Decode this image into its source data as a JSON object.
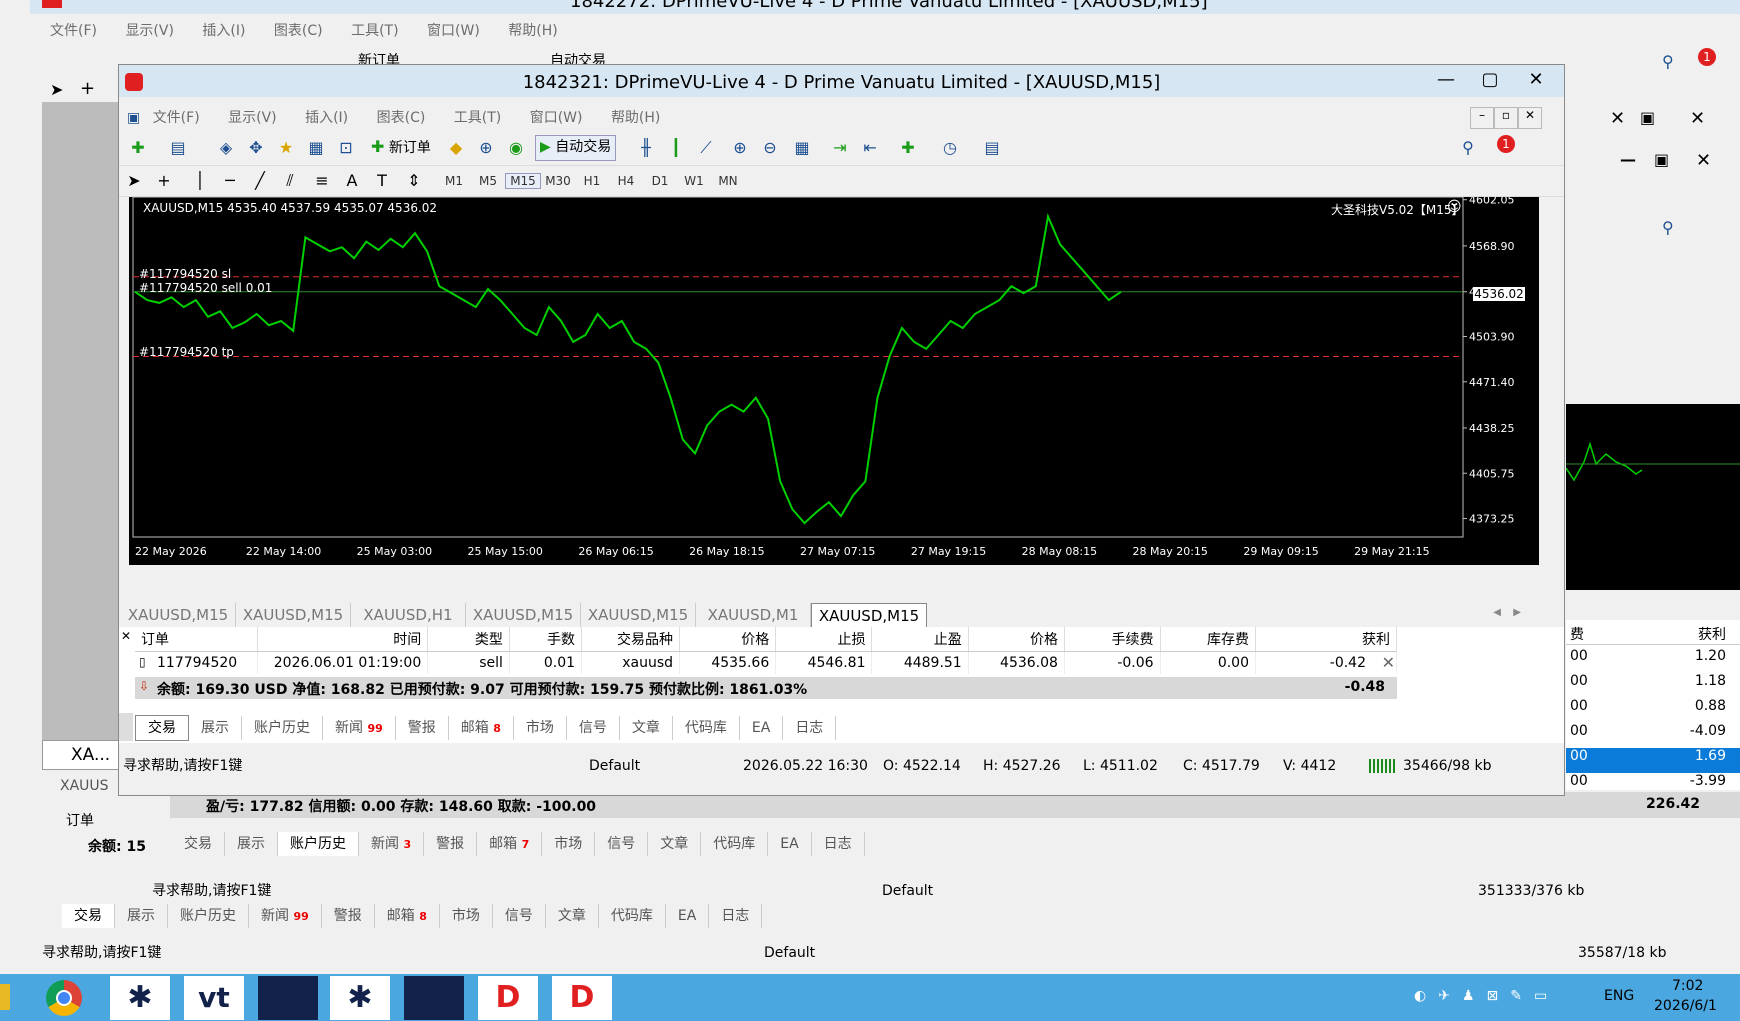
{
  "back_window": {
    "title": "1842272: DPrimeVU-Live 4 - D Prime Vanuatu Limited - [XAUUSD,M15]",
    "menu": [
      "文件(F)",
      "显示(V)",
      "插入(I)",
      "图表(C)",
      "工具(T)",
      "窗口(W)",
      "帮助(H)"
    ],
    "toolbar": {
      "new_order": "新订单",
      "auto_trade": "自动交易"
    },
    "notif_count": "1",
    "left_tab": "XA...",
    "left_tab2": "XAUUS",
    "orders_header": "订单",
    "balance_short": "余额: 15",
    "summary": "盈/亏: 177.82  信用额: 0.00  存款: 148.60  取款: -100.00",
    "summary_total": "226.42",
    "tabs": [
      "交易",
      "展示",
      "账户历史",
      "新闻",
      "警报",
      "邮箱",
      "市场",
      "信号",
      "文章",
      "代码库",
      "EA",
      "日志"
    ],
    "news_badge": "3",
    "mail_badge": "7",
    "status_help": "寻求帮助,请按F1键",
    "status_profile": "Default",
    "status_kb": "351333/376 kb",
    "right_col_header": [
      "费",
      "获利"
    ],
    "right_col_values": [
      "1.20",
      "1.18",
      "0.88",
      "-4.09",
      "1.69",
      "-3.99"
    ],
    "right_col_left": [
      "00",
      "00",
      "00",
      "00",
      "00",
      "00"
    ]
  },
  "bottom_window": {
    "tabs": [
      "交易",
      "展示",
      "账户历史",
      "新闻",
      "警报",
      "邮箱",
      "市场",
      "信号",
      "文章",
      "代码库",
      "EA",
      "日志"
    ],
    "news_badge": "99",
    "mail_badge": "8",
    "status_help": "寻求帮助,请按F1键",
    "status_profile": "Default",
    "status_kb": "35587/18 kb"
  },
  "main_window": {
    "title": "1842321: DPrimeVU-Live 4 - D Prime Vanuatu Limited - [XAUUSD,M15]",
    "menu": [
      "文件(F)",
      "显示(V)",
      "插入(I)",
      "图表(C)",
      "工具(T)",
      "窗口(W)",
      "帮助(H)"
    ],
    "toolbar": {
      "new_order": "新订单",
      "auto_trade": "自动交易"
    },
    "notif_count": "1",
    "timeframes": [
      "M1",
      "M5",
      "M15",
      "M30",
      "H1",
      "H4",
      "D1",
      "W1",
      "MN"
    ],
    "active_timeframe": "M15",
    "chart_header": "XAUUSD,M15  4535.40 4537.59 4535.07 4536.02",
    "indicator_label": "大圣科技V5.02【M15】",
    "sl_label": "#117794520 sl",
    "sell_label": "#117794520 sell 0.01",
    "tp_label": "#117794520 tp",
    "current_price": "4536.02",
    "chart_tabs": [
      "XAUUSD,M15",
      "XAUUSD,M15",
      "XAUUSD,H1",
      "XAUUSD,M15",
      "XAUUSD,M15",
      "XAUUSD,M1",
      "XAUUSD,M15"
    ],
    "orders_table": {
      "headers": [
        "订单",
        "时间",
        "类型",
        "手数",
        "交易品种",
        "价格",
        "止损",
        "止盈",
        "价格",
        "手续费",
        "库存费",
        "获利"
      ],
      "row": [
        "117794520",
        "2026.06.01 01:19:00",
        "sell",
        "0.01",
        "xauusd",
        "4535.66",
        "4546.81",
        "4489.51",
        "4536.08",
        "-0.06",
        "0.00",
        "-0.42"
      ],
      "summary": "余额: 169.30 USD  净值: 168.82  已用预付款: 9.07  可用预付款: 159.75  预付款比例: 1861.03%",
      "summary_total": "-0.48"
    },
    "tabs": [
      "交易",
      "展示",
      "账户历史",
      "新闻",
      "警报",
      "邮箱",
      "市场",
      "信号",
      "文章",
      "代码库",
      "EA",
      "日志"
    ],
    "news_badge": "99",
    "mail_badge": "8",
    "status": {
      "help": "寻求帮助,请按F1键",
      "profile": "Default",
      "datetime": "2026.05.22 16:30",
      "open": "O: 4522.14",
      "high": "H: 4527.26",
      "low": "L: 4511.02",
      "close": "C: 4517.79",
      "volume": "V: 4412",
      "kb": "35466/98 kb"
    }
  },
  "chart_data": {
    "type": "line",
    "title": "XAUUSD,M15",
    "x_ticks": [
      "22 May 2026",
      "22 May 14:00",
      "25 May 03:00",
      "25 May 15:00",
      "26 May 06:15",
      "26 May 18:15",
      "27 May 07:15",
      "27 May 19:15",
      "28 May 08:15",
      "28 May 20:15",
      "29 May 09:15",
      "29 May 21:15"
    ],
    "y_ticks": [
      4602.05,
      4568.9,
      4536.02,
      4503.9,
      4471.4,
      4438.25,
      4405.75,
      4373.25
    ],
    "ylim": [
      4360,
      4604
    ],
    "series": [
      {
        "values": [
          4536,
          4530,
          4528,
          4532,
          4525,
          4530,
          4518,
          4522,
          4510,
          4514,
          4520,
          4512,
          4515,
          4508,
          4575,
          4570,
          4565,
          4568,
          4560,
          4572,
          4566,
          4574,
          4568,
          4578,
          4565,
          4540,
          4535,
          4530,
          4525,
          4538,
          4530,
          4520,
          4510,
          4505,
          4525,
          4515,
          4500,
          4505,
          4520,
          4510,
          4515,
          4500,
          4495,
          4485,
          4460,
          4430,
          4420,
          4440,
          4450,
          4455,
          4450,
          4460,
          4445,
          4400,
          4380,
          4370,
          4378,
          4385,
          4375,
          4390,
          4400,
          4460,
          4490,
          4510,
          4500,
          4495,
          4505,
          4515,
          4510,
          4520,
          4525,
          4530,
          4540,
          4535,
          4540,
          4590,
          4570,
          4560,
          4550,
          4540,
          4530,
          4536
        ]
      },
      {
        "values": [
          4546.81,
          4546.81
        ]
      },
      {
        "values": [
          4536.02,
          4536.02
        ]
      },
      {
        "values": [
          4489.51,
          4489.51
        ]
      }
    ]
  },
  "taskbar": {
    "lang": "ENG",
    "time": "7:02",
    "date": "2026/6/1"
  }
}
